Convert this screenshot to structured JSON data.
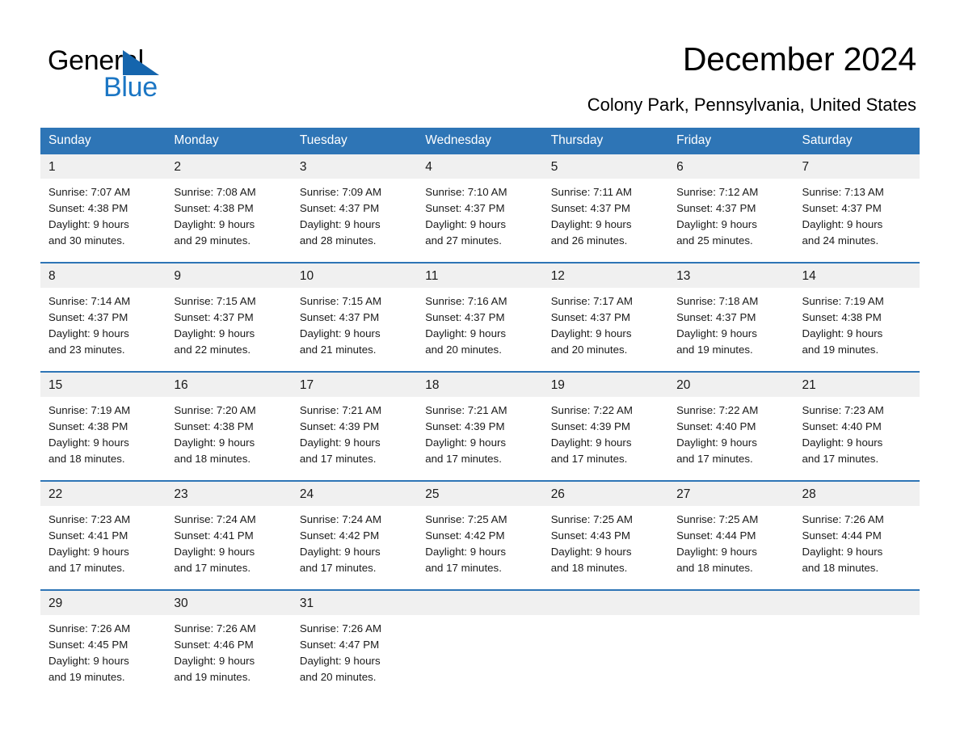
{
  "brand": {
    "name_part1": "General",
    "name_part2": "Blue",
    "triangle_color": "#1565ad",
    "blue_color": "#1b76c4"
  },
  "header": {
    "title": "December 2024",
    "subtitle": "Colony Park, Pennsylvania, United States"
  },
  "theme": {
    "header_blue": "#2e75b6",
    "daynum_background": "#f0f0f0",
    "page_background": "#ffffff",
    "text_color": "#1a1a1a"
  },
  "weekdays": [
    "Sunday",
    "Monday",
    "Tuesday",
    "Wednesday",
    "Thursday",
    "Friday",
    "Saturday"
  ],
  "weeks": [
    [
      {
        "day": "1",
        "sunrise": "Sunrise: 7:07 AM",
        "sunset": "Sunset: 4:38 PM",
        "daylight1": "Daylight: 9 hours",
        "daylight2": "and 30 minutes."
      },
      {
        "day": "2",
        "sunrise": "Sunrise: 7:08 AM",
        "sunset": "Sunset: 4:38 PM",
        "daylight1": "Daylight: 9 hours",
        "daylight2": "and 29 minutes."
      },
      {
        "day": "3",
        "sunrise": "Sunrise: 7:09 AM",
        "sunset": "Sunset: 4:37 PM",
        "daylight1": "Daylight: 9 hours",
        "daylight2": "and 28 minutes."
      },
      {
        "day": "4",
        "sunrise": "Sunrise: 7:10 AM",
        "sunset": "Sunset: 4:37 PM",
        "daylight1": "Daylight: 9 hours",
        "daylight2": "and 27 minutes."
      },
      {
        "day": "5",
        "sunrise": "Sunrise: 7:11 AM",
        "sunset": "Sunset: 4:37 PM",
        "daylight1": "Daylight: 9 hours",
        "daylight2": "and 26 minutes."
      },
      {
        "day": "6",
        "sunrise": "Sunrise: 7:12 AM",
        "sunset": "Sunset: 4:37 PM",
        "daylight1": "Daylight: 9 hours",
        "daylight2": "and 25 minutes."
      },
      {
        "day": "7",
        "sunrise": "Sunrise: 7:13 AM",
        "sunset": "Sunset: 4:37 PM",
        "daylight1": "Daylight: 9 hours",
        "daylight2": "and 24 minutes."
      }
    ],
    [
      {
        "day": "8",
        "sunrise": "Sunrise: 7:14 AM",
        "sunset": "Sunset: 4:37 PM",
        "daylight1": "Daylight: 9 hours",
        "daylight2": "and 23 minutes."
      },
      {
        "day": "9",
        "sunrise": "Sunrise: 7:15 AM",
        "sunset": "Sunset: 4:37 PM",
        "daylight1": "Daylight: 9 hours",
        "daylight2": "and 22 minutes."
      },
      {
        "day": "10",
        "sunrise": "Sunrise: 7:15 AM",
        "sunset": "Sunset: 4:37 PM",
        "daylight1": "Daylight: 9 hours",
        "daylight2": "and 21 minutes."
      },
      {
        "day": "11",
        "sunrise": "Sunrise: 7:16 AM",
        "sunset": "Sunset: 4:37 PM",
        "daylight1": "Daylight: 9 hours",
        "daylight2": "and 20 minutes."
      },
      {
        "day": "12",
        "sunrise": "Sunrise: 7:17 AM",
        "sunset": "Sunset: 4:37 PM",
        "daylight1": "Daylight: 9 hours",
        "daylight2": "and 20 minutes."
      },
      {
        "day": "13",
        "sunrise": "Sunrise: 7:18 AM",
        "sunset": "Sunset: 4:37 PM",
        "daylight1": "Daylight: 9 hours",
        "daylight2": "and 19 minutes."
      },
      {
        "day": "14",
        "sunrise": "Sunrise: 7:19 AM",
        "sunset": "Sunset: 4:38 PM",
        "daylight1": "Daylight: 9 hours",
        "daylight2": "and 19 minutes."
      }
    ],
    [
      {
        "day": "15",
        "sunrise": "Sunrise: 7:19 AM",
        "sunset": "Sunset: 4:38 PM",
        "daylight1": "Daylight: 9 hours",
        "daylight2": "and 18 minutes."
      },
      {
        "day": "16",
        "sunrise": "Sunrise: 7:20 AM",
        "sunset": "Sunset: 4:38 PM",
        "daylight1": "Daylight: 9 hours",
        "daylight2": "and 18 minutes."
      },
      {
        "day": "17",
        "sunrise": "Sunrise: 7:21 AM",
        "sunset": "Sunset: 4:39 PM",
        "daylight1": "Daylight: 9 hours",
        "daylight2": "and 17 minutes."
      },
      {
        "day": "18",
        "sunrise": "Sunrise: 7:21 AM",
        "sunset": "Sunset: 4:39 PM",
        "daylight1": "Daylight: 9 hours",
        "daylight2": "and 17 minutes."
      },
      {
        "day": "19",
        "sunrise": "Sunrise: 7:22 AM",
        "sunset": "Sunset: 4:39 PM",
        "daylight1": "Daylight: 9 hours",
        "daylight2": "and 17 minutes."
      },
      {
        "day": "20",
        "sunrise": "Sunrise: 7:22 AM",
        "sunset": "Sunset: 4:40 PM",
        "daylight1": "Daylight: 9 hours",
        "daylight2": "and 17 minutes."
      },
      {
        "day": "21",
        "sunrise": "Sunrise: 7:23 AM",
        "sunset": "Sunset: 4:40 PM",
        "daylight1": "Daylight: 9 hours",
        "daylight2": "and 17 minutes."
      }
    ],
    [
      {
        "day": "22",
        "sunrise": "Sunrise: 7:23 AM",
        "sunset": "Sunset: 4:41 PM",
        "daylight1": "Daylight: 9 hours",
        "daylight2": "and 17 minutes."
      },
      {
        "day": "23",
        "sunrise": "Sunrise: 7:24 AM",
        "sunset": "Sunset: 4:41 PM",
        "daylight1": "Daylight: 9 hours",
        "daylight2": "and 17 minutes."
      },
      {
        "day": "24",
        "sunrise": "Sunrise: 7:24 AM",
        "sunset": "Sunset: 4:42 PM",
        "daylight1": "Daylight: 9 hours",
        "daylight2": "and 17 minutes."
      },
      {
        "day": "25",
        "sunrise": "Sunrise: 7:25 AM",
        "sunset": "Sunset: 4:42 PM",
        "daylight1": "Daylight: 9 hours",
        "daylight2": "and 17 minutes."
      },
      {
        "day": "26",
        "sunrise": "Sunrise: 7:25 AM",
        "sunset": "Sunset: 4:43 PM",
        "daylight1": "Daylight: 9 hours",
        "daylight2": "and 18 minutes."
      },
      {
        "day": "27",
        "sunrise": "Sunrise: 7:25 AM",
        "sunset": "Sunset: 4:44 PM",
        "daylight1": "Daylight: 9 hours",
        "daylight2": "and 18 minutes."
      },
      {
        "day": "28",
        "sunrise": "Sunrise: 7:26 AM",
        "sunset": "Sunset: 4:44 PM",
        "daylight1": "Daylight: 9 hours",
        "daylight2": "and 18 minutes."
      }
    ],
    [
      {
        "day": "29",
        "sunrise": "Sunrise: 7:26 AM",
        "sunset": "Sunset: 4:45 PM",
        "daylight1": "Daylight: 9 hours",
        "daylight2": "and 19 minutes."
      },
      {
        "day": "30",
        "sunrise": "Sunrise: 7:26 AM",
        "sunset": "Sunset: 4:46 PM",
        "daylight1": "Daylight: 9 hours",
        "daylight2": "and 19 minutes."
      },
      {
        "day": "31",
        "sunrise": "Sunrise: 7:26 AM",
        "sunset": "Sunset: 4:47 PM",
        "daylight1": "Daylight: 9 hours",
        "daylight2": "and 20 minutes."
      },
      {
        "day": "",
        "sunrise": "",
        "sunset": "",
        "daylight1": "",
        "daylight2": ""
      },
      {
        "day": "",
        "sunrise": "",
        "sunset": "",
        "daylight1": "",
        "daylight2": ""
      },
      {
        "day": "",
        "sunrise": "",
        "sunset": "",
        "daylight1": "",
        "daylight2": ""
      },
      {
        "day": "",
        "sunrise": "",
        "sunset": "",
        "daylight1": "",
        "daylight2": ""
      }
    ]
  ]
}
